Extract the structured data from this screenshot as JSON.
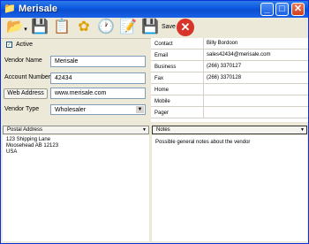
{
  "window": {
    "title": "Merisale",
    "app_icon": "folder-icon",
    "controls": {
      "minimize": "_",
      "maximize": "□",
      "close": "✕"
    }
  },
  "toolbar": {
    "items": [
      {
        "name": "Open / new",
        "icon": "folder-open-icon",
        "glyph": "📂"
      },
      {
        "name": "Save document",
        "icon": "floppy-icon",
        "glyph": "💾"
      },
      {
        "name": "Clipboard",
        "icon": "clipboard-icon",
        "glyph": "📋"
      },
      {
        "name": "Settings",
        "icon": "flower-gear-icon",
        "glyph": "✿"
      },
      {
        "name": "Schedule",
        "icon": "clock-icon",
        "glyph": "🕐"
      },
      {
        "name": "Edit",
        "icon": "pencil-notepad-icon",
        "glyph": "📝"
      },
      {
        "name": "Export",
        "icon": "save-disk-icon",
        "glyph": "💾"
      }
    ],
    "save_label": "Save",
    "delete_icon": "delete-x-icon"
  },
  "form": {
    "active_label": "Active",
    "active_checked": true,
    "vendor_name_label": "Vendor Name",
    "vendor_name": "Merisale",
    "account_number_label": "Account Number",
    "account_number": "42434",
    "web_address_button": "Web Address",
    "web_address": "www.merisale.com",
    "vendor_type_label": "Vendor Type",
    "vendor_type": "Wholesaler"
  },
  "contact_grid": [
    {
      "key": "Contact",
      "value": "Billy Bordoon"
    },
    {
      "key": "Email",
      "value": "sales42434@merisale.com"
    },
    {
      "key": "Business",
      "value": "(266) 3370127"
    },
    {
      "key": "Fax",
      "value": "(266) 3370128"
    },
    {
      "key": "Home",
      "value": ""
    },
    {
      "key": "Mobile",
      "value": ""
    },
    {
      "key": "Pager",
      "value": ""
    }
  ],
  "address_panel": {
    "selector": "Postal Address",
    "lines": [
      "123 Shipping Lane",
      "Moosehead AB  12123",
      "USA"
    ]
  },
  "notes_panel": {
    "selector": "Notes",
    "text": "Possible general notes about the vendor"
  }
}
